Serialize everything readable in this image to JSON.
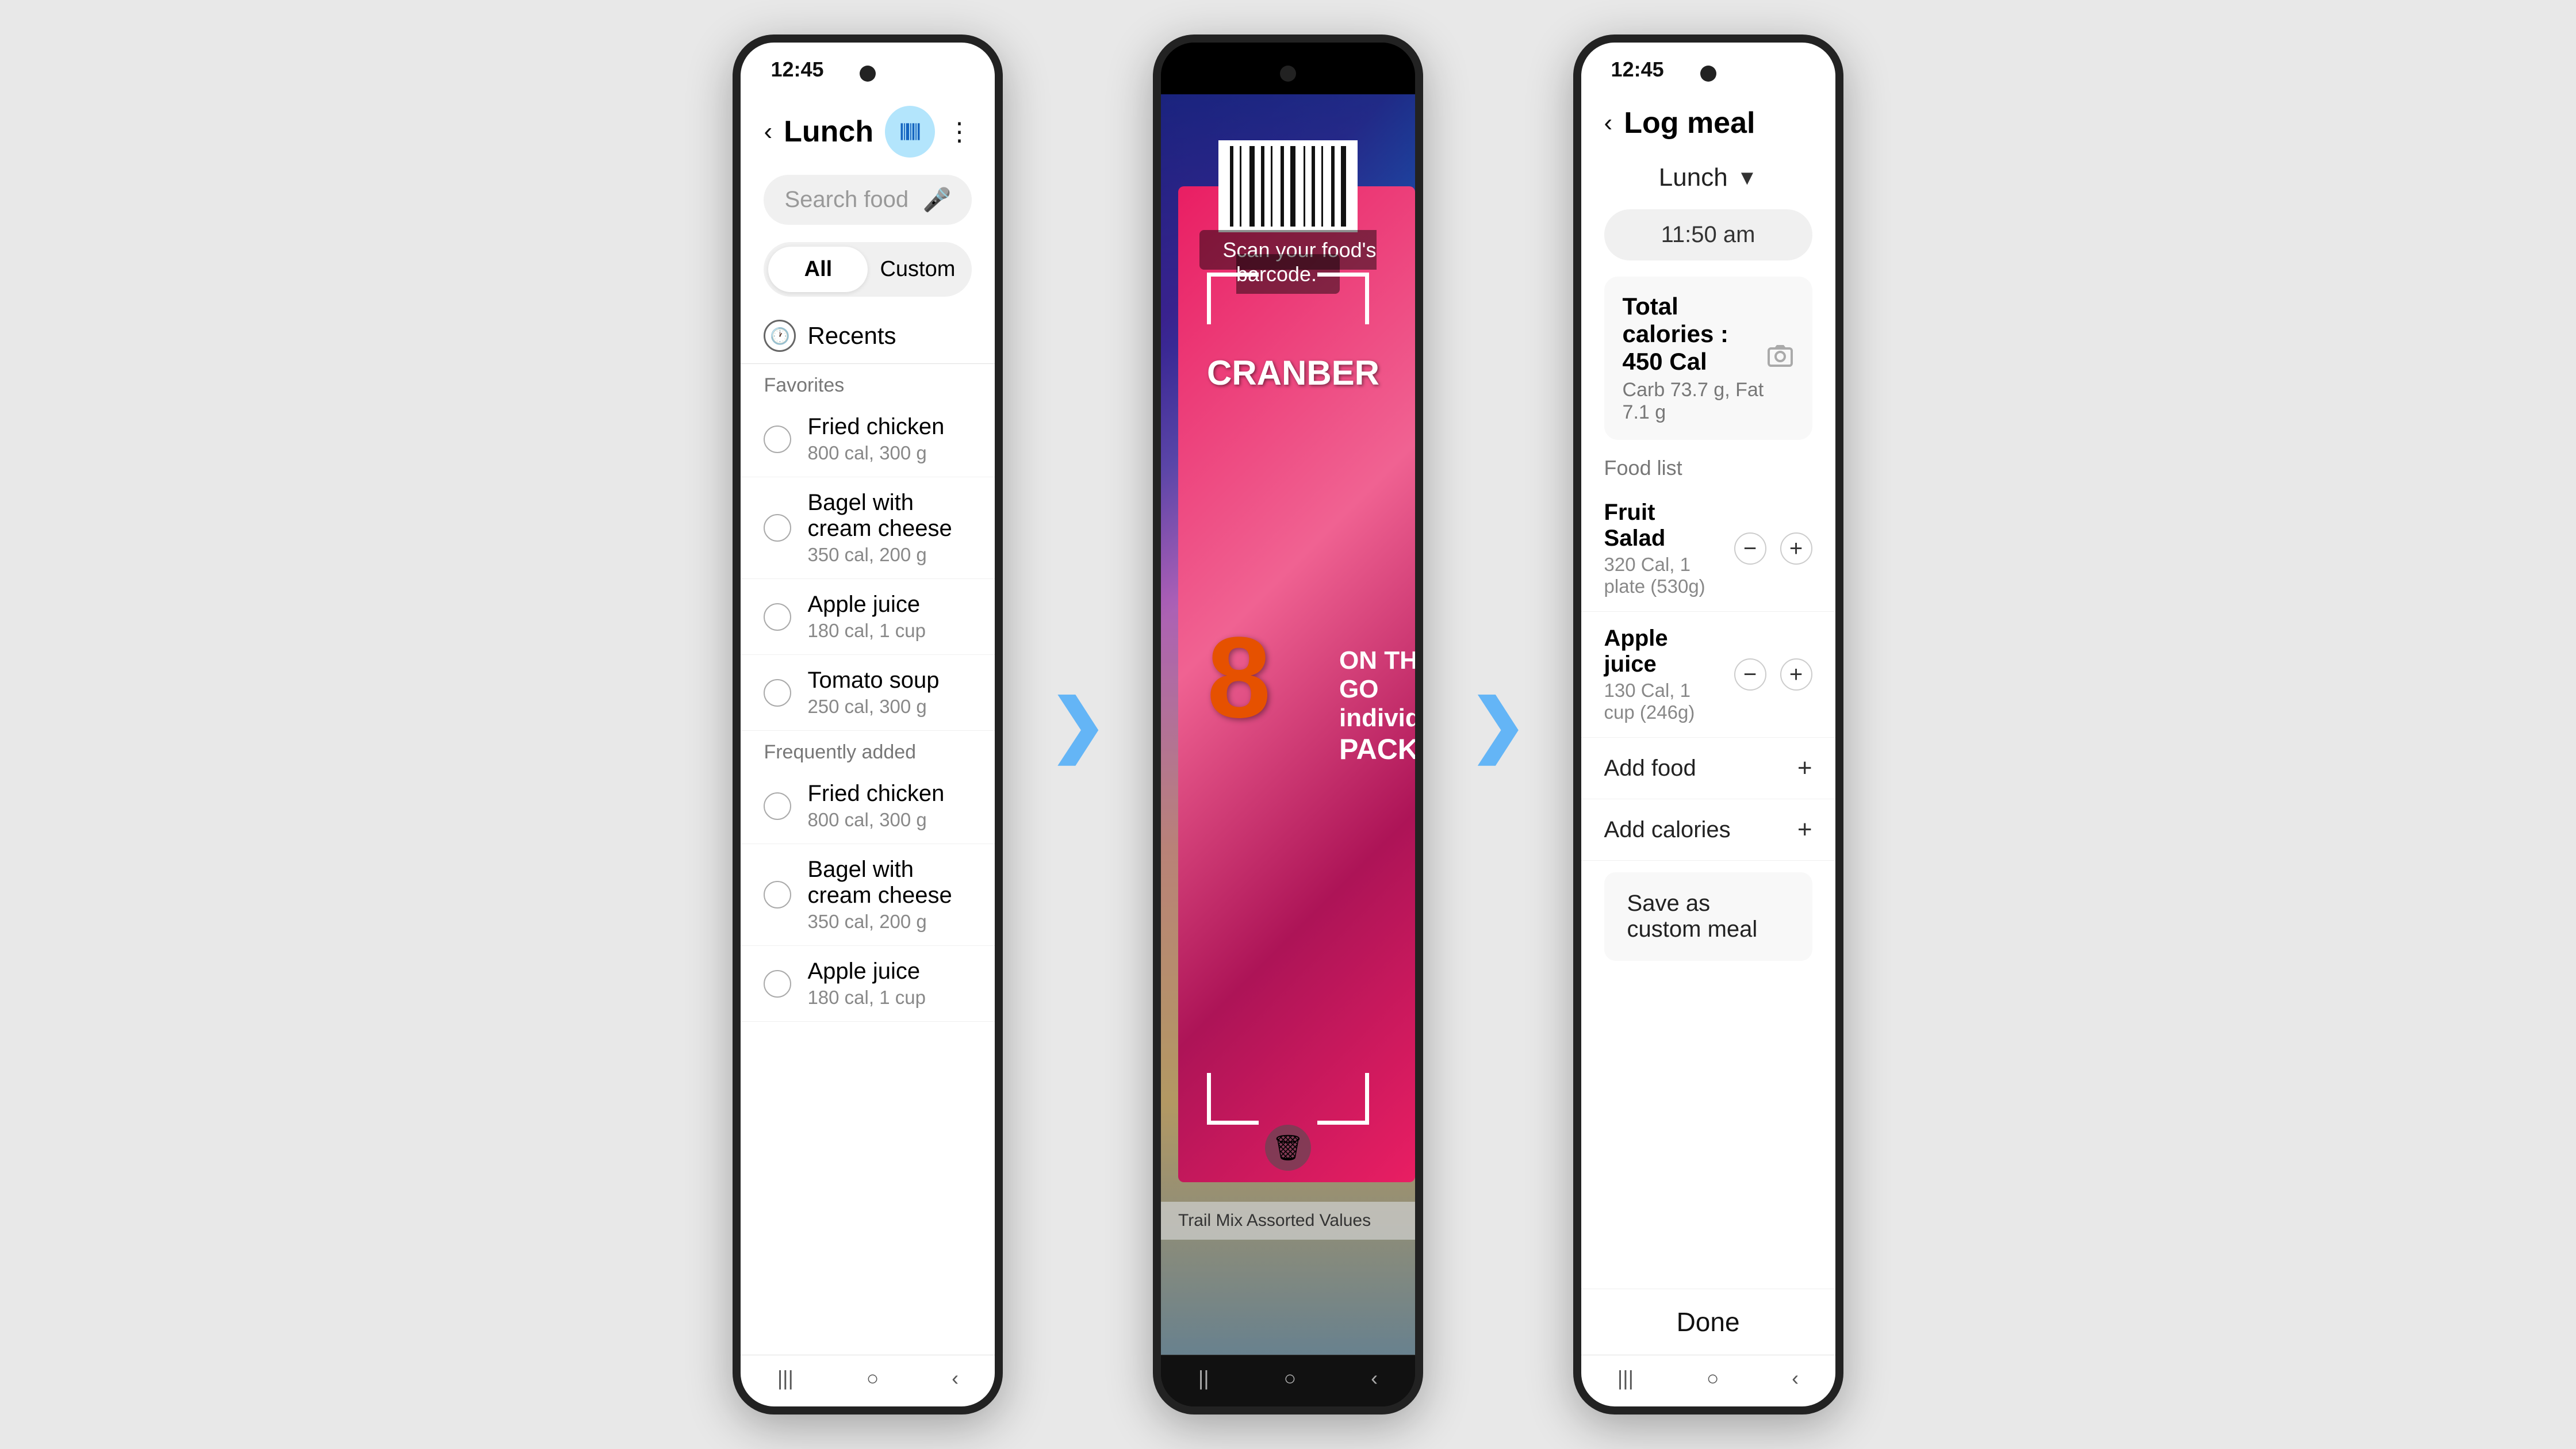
{
  "phone1": {
    "time": "12:45",
    "header": {
      "back_label": "‹",
      "title": "Lunch",
      "more_label": "⋮"
    },
    "search": {
      "placeholder": "Search food",
      "mic_icon": "mic-icon"
    },
    "tabs": [
      {
        "label": "All",
        "active": true
      },
      {
        "label": "Custom",
        "active": false
      }
    ],
    "recents_label": "Recents",
    "sections": [
      {
        "title": "Favorites",
        "items": [
          {
            "name": "Fried chicken",
            "detail": "800 cal, 300 g"
          },
          {
            "name": "Bagel with cream cheese",
            "detail": "350 cal, 200 g"
          },
          {
            "name": "Apple juice",
            "detail": "180 cal, 1 cup"
          },
          {
            "name": "Tomato soup",
            "detail": "250 cal, 300 g"
          }
        ]
      },
      {
        "title": "Frequently added",
        "items": [
          {
            "name": "Fried chicken",
            "detail": "800 cal, 300 g"
          },
          {
            "name": "Bagel with cream cheese",
            "detail": "350 cal, 200 g"
          },
          {
            "name": "Apple juice",
            "detail": "180 cal, 1 cup"
          }
        ]
      }
    ],
    "nav": [
      "|||",
      "○",
      "‹"
    ]
  },
  "phone2": {
    "scan_hint": "Scan your food's barcode.",
    "cranberry_text": "CRANBER",
    "box_number": "8",
    "box_label": "ON THE GO individual",
    "packs_label": "PACKS",
    "price_text": "Trail Mix Assorted Values",
    "trash_icon": "trash-icon",
    "nav": [
      "||",
      "○",
      "‹"
    ]
  },
  "phone3": {
    "time": "12:45",
    "header": {
      "back_label": "‹",
      "title": "Log meal"
    },
    "meal_type": "Lunch",
    "meal_time": "11:50 am",
    "calories": {
      "title": "Total calories : 450 Cal",
      "detail": "Carb 73.7 g, Fat 7.1 g"
    },
    "food_list_label": "Food list",
    "food_items": [
      {
        "name": "Fruit Salad",
        "detail": "320 Cal, 1 plate (530g)"
      },
      {
        "name": "Apple juice",
        "detail": "130 Cal, 1 cup (246g)"
      }
    ],
    "add_food_label": "Add food",
    "add_calories_label": "Add calories",
    "save_custom_label": "Save as custom meal",
    "done_label": "Done",
    "nav": [
      "|||",
      "○",
      "‹"
    ]
  },
  "arrow_symbol": "❯"
}
